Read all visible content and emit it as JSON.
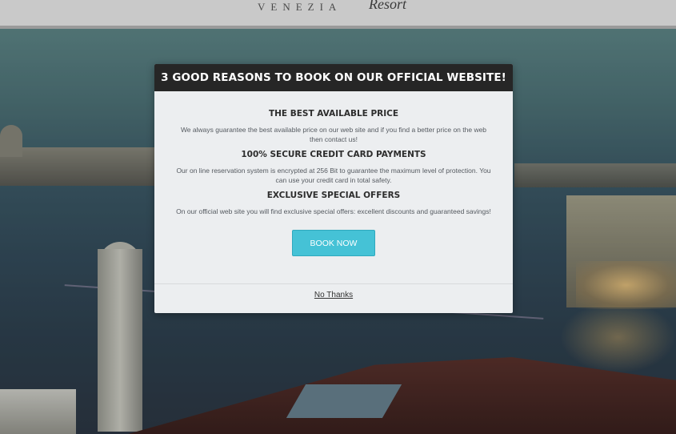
{
  "header": {
    "brand_city": "VENEZIA",
    "brand_resort": "Resort"
  },
  "modal": {
    "title": "3 GOOD REASONS TO BOOK ON OUR OFFICIAL WEBSITE!",
    "reasons": [
      {
        "title": "THE BEST AVAILABLE PRICE",
        "text": "We always guarantee the best available price on our web site and if you find a better price on the web then contact us!"
      },
      {
        "title": "100% SECURE CREDIT CARD PAYMENTS",
        "text": "Our on line reservation system is encrypted at 256 Bit to guarantee the maximum level of protection. You can use your credit card in total safety."
      },
      {
        "title": "EXCLUSIVE SPECIAL OFFERS",
        "text": "On our official web site you will find exclusive special offers: excellent discounts and guaranteed savings!"
      }
    ],
    "book_label": "BOOK NOW",
    "dismiss_label": "No Thanks"
  },
  "colors": {
    "accent": "#45c2d6",
    "modal_header": "#262626",
    "modal_body": "#eceef0"
  }
}
